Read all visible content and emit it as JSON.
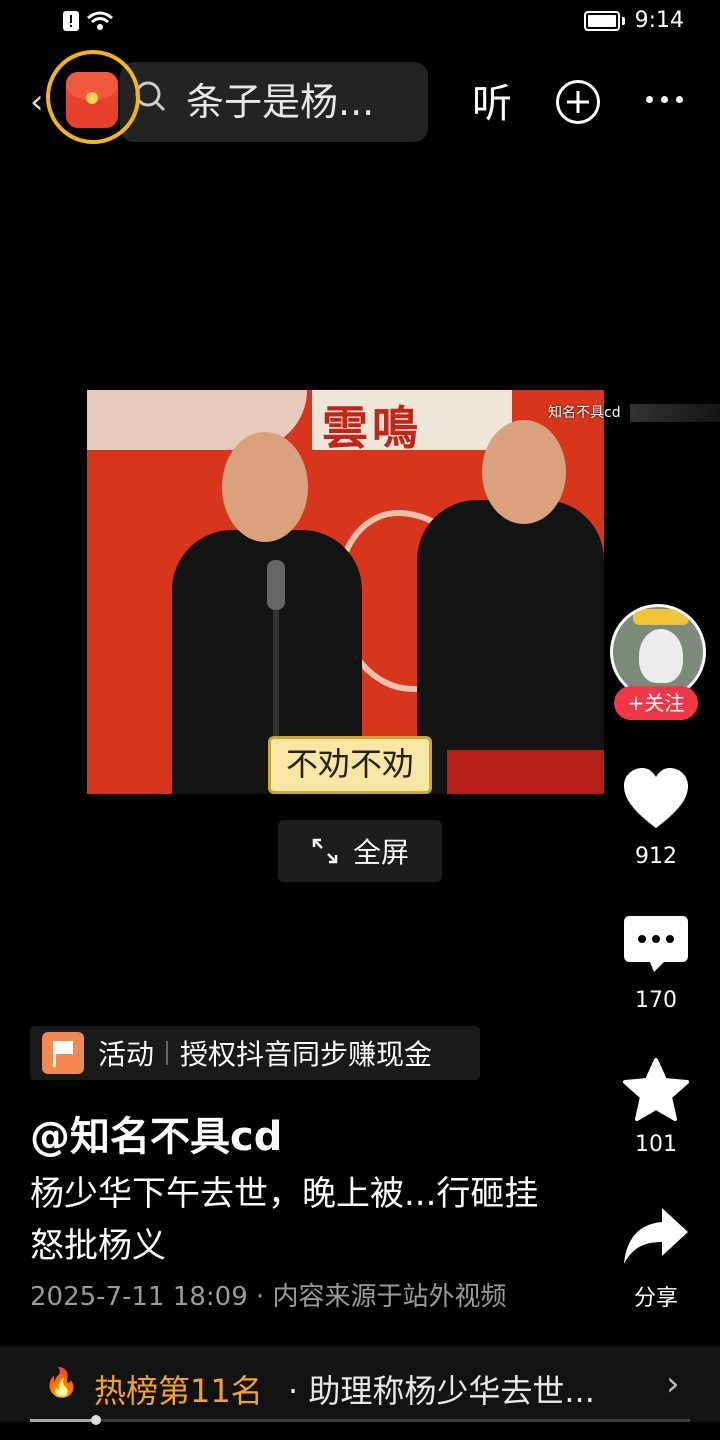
{
  "status_bar": {
    "time": "9:14"
  },
  "top_bar": {
    "back_icon": "chevron-left-icon",
    "search_text": "条子是杨...",
    "listen_label": "听",
    "add_icon": "plus-circle-icon",
    "more_icon": "more-dots-icon"
  },
  "video": {
    "subtitle": "不劝不劝",
    "watermark": "知名不具cd",
    "banner_text": "雲鳴"
  },
  "fullscreen": {
    "label": "全屏"
  },
  "right_rail": {
    "follow_label": "+关注",
    "like_count": "912",
    "comment_count": "170",
    "favorite_count": "101",
    "share_label": "分享"
  },
  "activity": {
    "tag": "活动",
    "text": "授权抖音同步赚现金"
  },
  "post": {
    "author": "@知名不具cd",
    "description": "杨少华下午去世，晚上被...行砸挂怒批杨义",
    "meta": "2025-7-11 18:09 · 内容来源于站外视频"
  },
  "hot_list": {
    "rank": "热榜第11名",
    "text": "· 助理称杨少华去世...",
    "accent": "#f5a037"
  },
  "playback": {
    "progress": 0.1
  }
}
